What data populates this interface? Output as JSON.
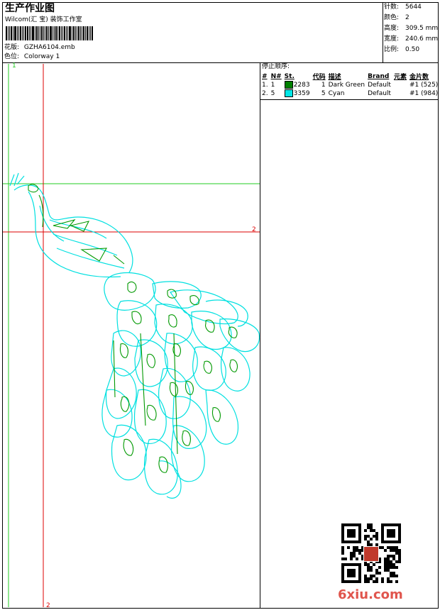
{
  "header": {
    "title": "生产作业图",
    "company": "Wilcom(汇 宝) 装饰工作室",
    "design_label": "花版:",
    "design_value": "GZHA6104.emb",
    "colorway_label": "色位:",
    "colorway_value": "Colorway 1"
  },
  "specs": [
    {
      "label": "针数:",
      "value": "5644"
    },
    {
      "label": "颜色:",
      "value": "2"
    },
    {
      "label": "高度:",
      "value": "309.5 mm"
    },
    {
      "label": "宽度:",
      "value": "240.6 mm"
    },
    {
      "label": "比例:",
      "value": "0.50"
    }
  ],
  "stop_sequence": {
    "heading": "停止顺序:",
    "columns": [
      "#",
      "N#",
      "St.",
      "代码",
      "描述",
      "Brand",
      "元素",
      "金片数"
    ],
    "rows": [
      {
        "idx": "1.",
        "n": "1",
        "color": "#008000",
        "st": "2283",
        "code": "1",
        "desc": "Dark Green",
        "brand": "Default",
        "elem": "",
        "seq": "#1 (525)"
      },
      {
        "idx": "2.",
        "n": "5",
        "color": "#00e6e6",
        "st": "3359",
        "code": "5",
        "desc": "Cyan",
        "brand": "Default",
        "elem": "",
        "seq": "#1 (984)"
      }
    ]
  },
  "guides": {
    "green_top": "1",
    "red_right": "2",
    "red_bottom": "2"
  },
  "watermark": "6xiu.com",
  "colors": {
    "guide_green": "#22cc22",
    "guide_red": "#dd0000",
    "outline_cyan": "#00e0e0",
    "detail_green": "#009900"
  }
}
